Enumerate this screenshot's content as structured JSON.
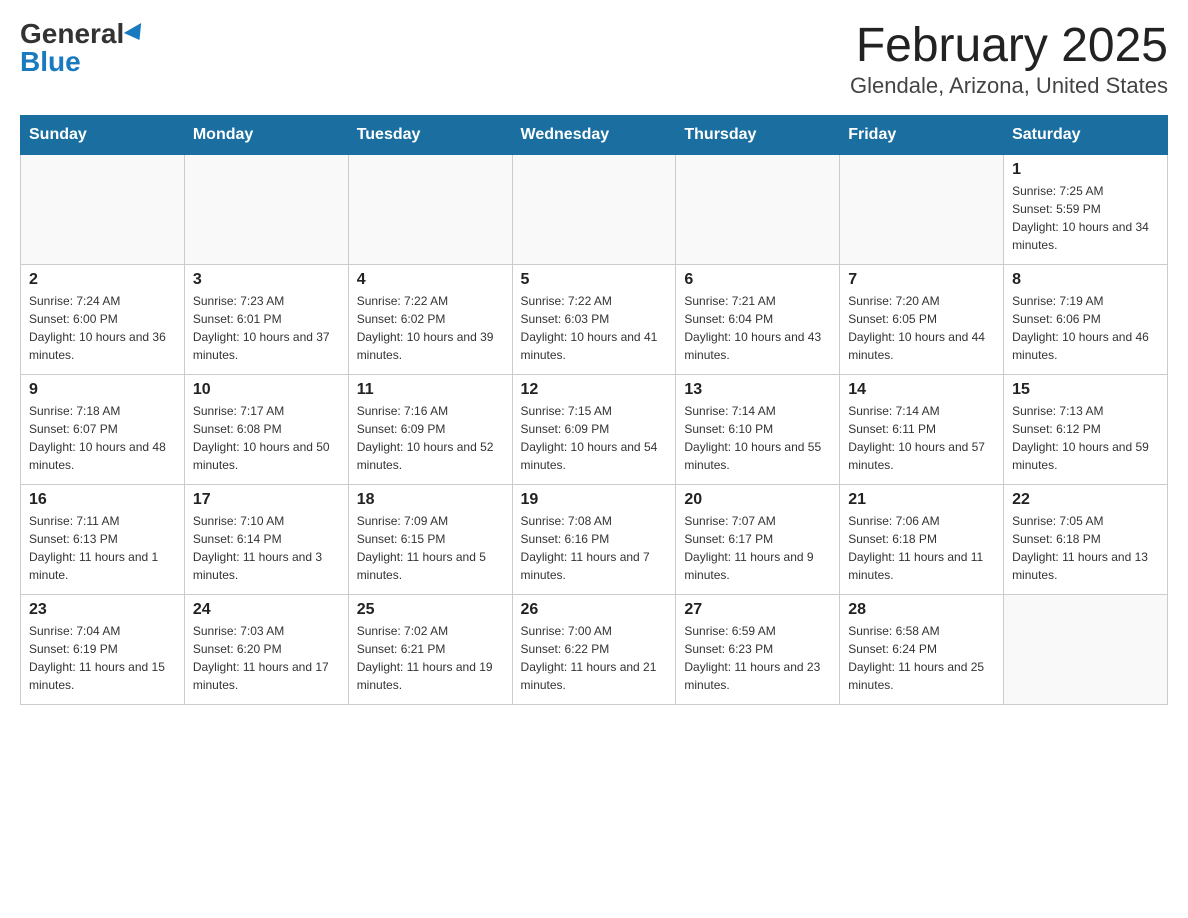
{
  "header": {
    "logo_general": "General",
    "logo_blue": "Blue",
    "month_year": "February 2025",
    "location": "Glendale, Arizona, United States"
  },
  "days_of_week": [
    "Sunday",
    "Monday",
    "Tuesday",
    "Wednesday",
    "Thursday",
    "Friday",
    "Saturday"
  ],
  "weeks": [
    [
      {
        "day": "",
        "info": ""
      },
      {
        "day": "",
        "info": ""
      },
      {
        "day": "",
        "info": ""
      },
      {
        "day": "",
        "info": ""
      },
      {
        "day": "",
        "info": ""
      },
      {
        "day": "",
        "info": ""
      },
      {
        "day": "1",
        "info": "Sunrise: 7:25 AM\nSunset: 5:59 PM\nDaylight: 10 hours and 34 minutes."
      }
    ],
    [
      {
        "day": "2",
        "info": "Sunrise: 7:24 AM\nSunset: 6:00 PM\nDaylight: 10 hours and 36 minutes."
      },
      {
        "day": "3",
        "info": "Sunrise: 7:23 AM\nSunset: 6:01 PM\nDaylight: 10 hours and 37 minutes."
      },
      {
        "day": "4",
        "info": "Sunrise: 7:22 AM\nSunset: 6:02 PM\nDaylight: 10 hours and 39 minutes."
      },
      {
        "day": "5",
        "info": "Sunrise: 7:22 AM\nSunset: 6:03 PM\nDaylight: 10 hours and 41 minutes."
      },
      {
        "day": "6",
        "info": "Sunrise: 7:21 AM\nSunset: 6:04 PM\nDaylight: 10 hours and 43 minutes."
      },
      {
        "day": "7",
        "info": "Sunrise: 7:20 AM\nSunset: 6:05 PM\nDaylight: 10 hours and 44 minutes."
      },
      {
        "day": "8",
        "info": "Sunrise: 7:19 AM\nSunset: 6:06 PM\nDaylight: 10 hours and 46 minutes."
      }
    ],
    [
      {
        "day": "9",
        "info": "Sunrise: 7:18 AM\nSunset: 6:07 PM\nDaylight: 10 hours and 48 minutes."
      },
      {
        "day": "10",
        "info": "Sunrise: 7:17 AM\nSunset: 6:08 PM\nDaylight: 10 hours and 50 minutes."
      },
      {
        "day": "11",
        "info": "Sunrise: 7:16 AM\nSunset: 6:09 PM\nDaylight: 10 hours and 52 minutes."
      },
      {
        "day": "12",
        "info": "Sunrise: 7:15 AM\nSunset: 6:09 PM\nDaylight: 10 hours and 54 minutes."
      },
      {
        "day": "13",
        "info": "Sunrise: 7:14 AM\nSunset: 6:10 PM\nDaylight: 10 hours and 55 minutes."
      },
      {
        "day": "14",
        "info": "Sunrise: 7:14 AM\nSunset: 6:11 PM\nDaylight: 10 hours and 57 minutes."
      },
      {
        "day": "15",
        "info": "Sunrise: 7:13 AM\nSunset: 6:12 PM\nDaylight: 10 hours and 59 minutes."
      }
    ],
    [
      {
        "day": "16",
        "info": "Sunrise: 7:11 AM\nSunset: 6:13 PM\nDaylight: 11 hours and 1 minute."
      },
      {
        "day": "17",
        "info": "Sunrise: 7:10 AM\nSunset: 6:14 PM\nDaylight: 11 hours and 3 minutes."
      },
      {
        "day": "18",
        "info": "Sunrise: 7:09 AM\nSunset: 6:15 PM\nDaylight: 11 hours and 5 minutes."
      },
      {
        "day": "19",
        "info": "Sunrise: 7:08 AM\nSunset: 6:16 PM\nDaylight: 11 hours and 7 minutes."
      },
      {
        "day": "20",
        "info": "Sunrise: 7:07 AM\nSunset: 6:17 PM\nDaylight: 11 hours and 9 minutes."
      },
      {
        "day": "21",
        "info": "Sunrise: 7:06 AM\nSunset: 6:18 PM\nDaylight: 11 hours and 11 minutes."
      },
      {
        "day": "22",
        "info": "Sunrise: 7:05 AM\nSunset: 6:18 PM\nDaylight: 11 hours and 13 minutes."
      }
    ],
    [
      {
        "day": "23",
        "info": "Sunrise: 7:04 AM\nSunset: 6:19 PM\nDaylight: 11 hours and 15 minutes."
      },
      {
        "day": "24",
        "info": "Sunrise: 7:03 AM\nSunset: 6:20 PM\nDaylight: 11 hours and 17 minutes."
      },
      {
        "day": "25",
        "info": "Sunrise: 7:02 AM\nSunset: 6:21 PM\nDaylight: 11 hours and 19 minutes."
      },
      {
        "day": "26",
        "info": "Sunrise: 7:00 AM\nSunset: 6:22 PM\nDaylight: 11 hours and 21 minutes."
      },
      {
        "day": "27",
        "info": "Sunrise: 6:59 AM\nSunset: 6:23 PM\nDaylight: 11 hours and 23 minutes."
      },
      {
        "day": "28",
        "info": "Sunrise: 6:58 AM\nSunset: 6:24 PM\nDaylight: 11 hours and 25 minutes."
      },
      {
        "day": "",
        "info": ""
      }
    ]
  ]
}
